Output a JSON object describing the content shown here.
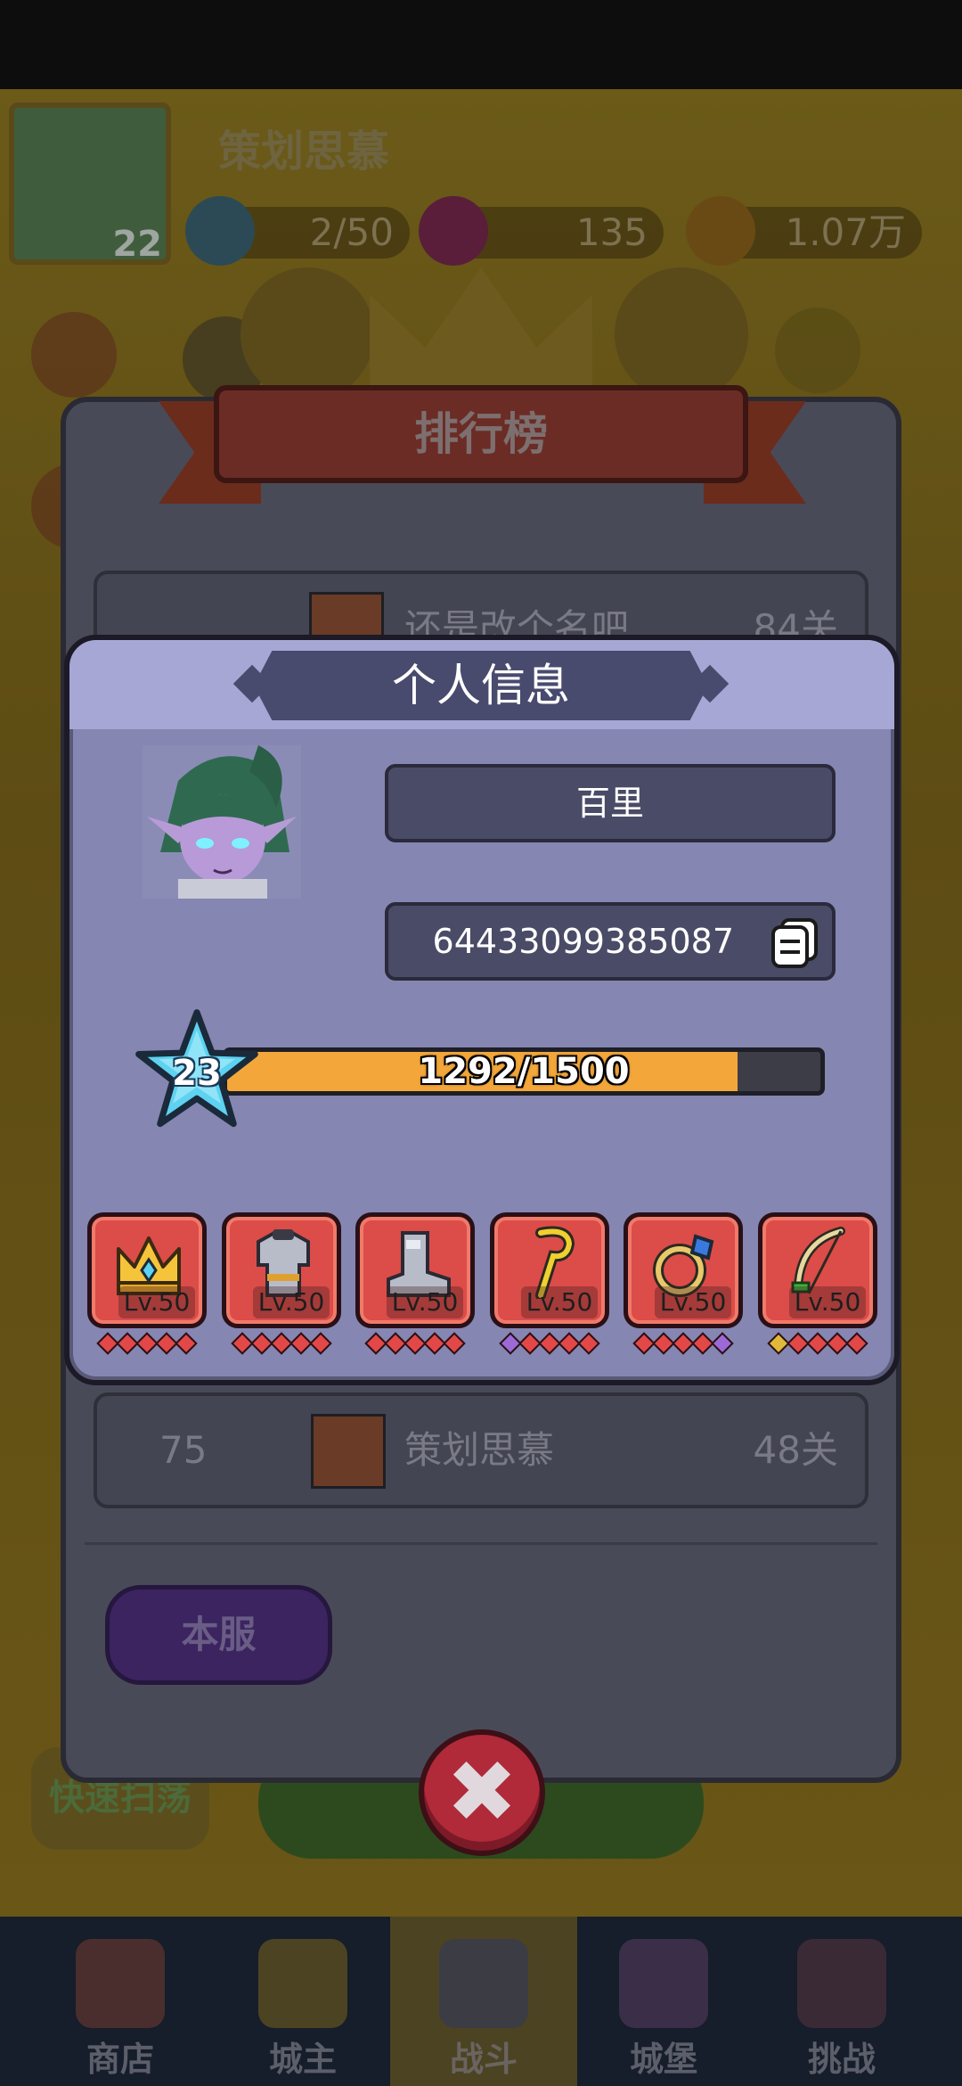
{
  "background": {
    "player_name": "策划思慕",
    "player_level": "22",
    "resources": [
      "2/50",
      "135",
      "1.07万"
    ],
    "quick_sweep": "快速扫荡",
    "nav": [
      "商店",
      "城主",
      "战斗",
      "城堡",
      "挑战"
    ]
  },
  "ranking": {
    "title": "排行榜",
    "partial_row": {
      "name": "还是改个名吧",
      "stage": "84关"
    },
    "row": {
      "rank": "75",
      "name": "策划思慕",
      "stage": "48关"
    },
    "server_button": "本服"
  },
  "popup": {
    "title": "个人信息",
    "name": "百里",
    "uid": "64433099385087",
    "level": "23",
    "xp_text": "1292/1500",
    "xp_fraction": 0.861,
    "equipment": [
      {
        "slot": "crown-icon",
        "level": "Lv.50",
        "gems": [
          "red",
          "red",
          "red",
          "red",
          "red"
        ]
      },
      {
        "slot": "armor-icon",
        "level": "Lv.50",
        "gems": [
          "red",
          "red",
          "red",
          "red",
          "red"
        ]
      },
      {
        "slot": "boots-icon",
        "level": "Lv.50",
        "gems": [
          "red",
          "red",
          "red",
          "red",
          "red"
        ]
      },
      {
        "slot": "staff-icon",
        "level": "Lv.50",
        "gems": [
          "purple",
          "red",
          "red",
          "red",
          "red"
        ]
      },
      {
        "slot": "ring-icon",
        "level": "Lv.50",
        "gems": [
          "red",
          "red",
          "red",
          "red",
          "purple"
        ]
      },
      {
        "slot": "bow-icon",
        "level": "Lv.50",
        "gems": [
          "gold",
          "red",
          "red",
          "red",
          "red"
        ]
      }
    ]
  },
  "colors": {
    "popup_bg": "#8586b2",
    "xp_fill": "#f3a73a",
    "equip_bg": "#dc4c49",
    "close_button": "#b02a3a"
  }
}
